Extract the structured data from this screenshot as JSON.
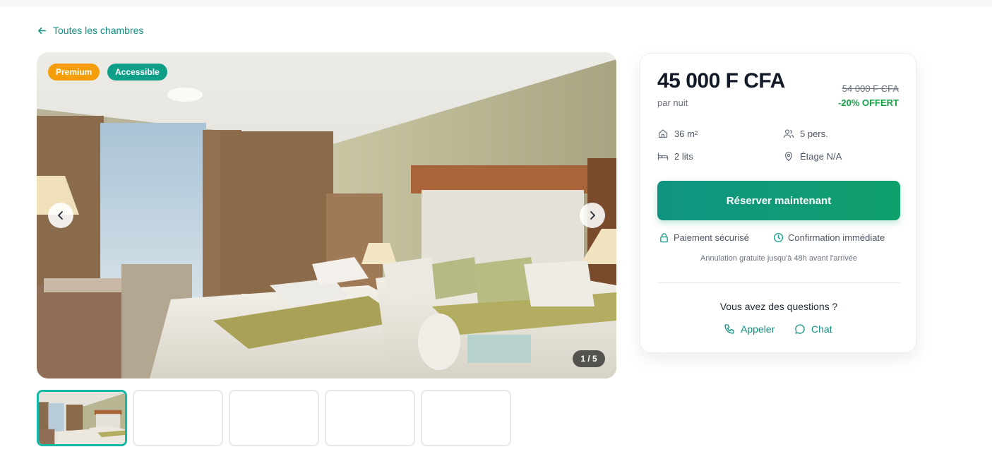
{
  "back_link": {
    "label": "Toutes les chambres"
  },
  "gallery": {
    "badges": [
      "Premium",
      "Accessible"
    ],
    "counter": "1 / 5",
    "total_thumbnails": 5,
    "active_index": 0
  },
  "booking": {
    "price": "45 000 F CFA",
    "per_night": "par nuit",
    "old_price": "54 000 F CFA",
    "discount": "-20% OFFERT",
    "features": {
      "area": "36 m²",
      "guests": "5 pers.",
      "beds": "2 lits",
      "floor": "Étage N/A"
    },
    "cta_label": "Réserver maintenant",
    "secure_label": "Paiement sécurisé",
    "confirm_label": "Confirmation immédiate",
    "cancellation_note": "Annulation gratuite jusqu'à 48h avant l'arrivée",
    "questions_title": "Vous avez des questions ?",
    "call_label": "Appeler",
    "chat_label": "Chat"
  },
  "colors": {
    "accent": "#0f8f80",
    "premium_badge": "#f59e0b",
    "accessible_badge": "#0f9e88",
    "discount": "#16a34a"
  }
}
